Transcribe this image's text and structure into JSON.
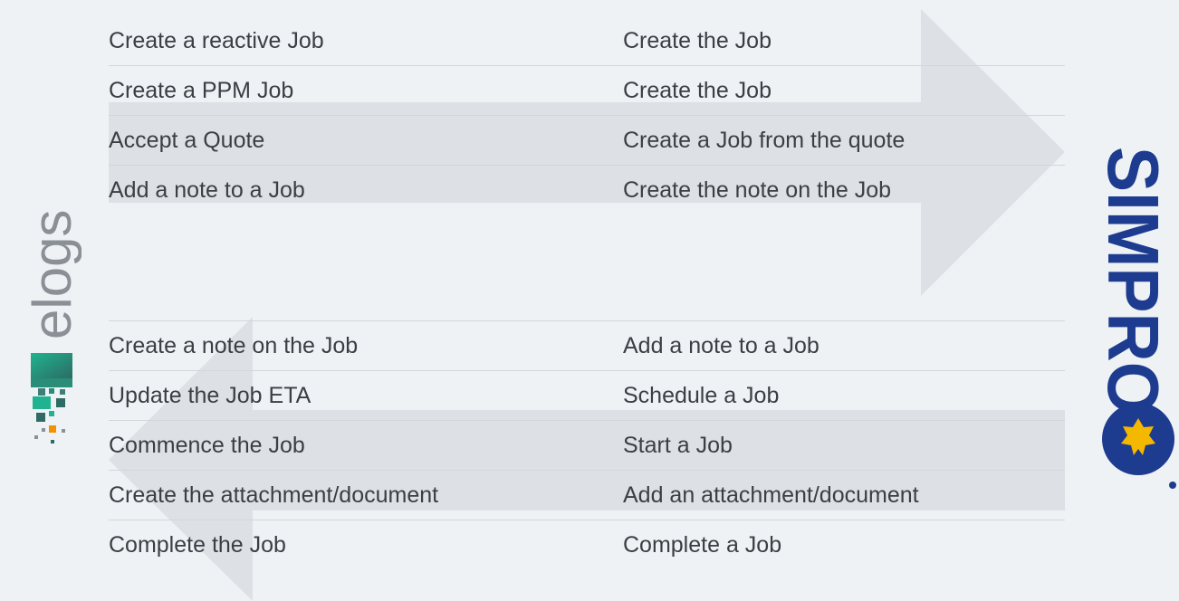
{
  "top_table": {
    "rows": [
      {
        "left": "Create a reactive Job",
        "right": "Create the Job"
      },
      {
        "left": "Create a PPM Job",
        "right": "Create the Job"
      },
      {
        "left": "Accept a Quote",
        "right": "Create a Job from the quote"
      },
      {
        "left": "Add a note to a Job",
        "right": "Create the note on the Job"
      }
    ]
  },
  "bottom_table": {
    "rows": [
      {
        "left": "Create a note on the Job",
        "right": "Add a note to a Job"
      },
      {
        "left": "Update the Job ETA",
        "right": "Schedule a Job"
      },
      {
        "left": "Commence the Job",
        "right": "Start a Job"
      },
      {
        "left": "Create the attachment/document",
        "right": "Add an attachment/document"
      },
      {
        "left": "Complete the Job",
        "right": "Complete a Job"
      }
    ]
  },
  "logos": {
    "left_word": "elogs",
    "right_word": "SIMPRO"
  },
  "colors": {
    "background": "#eef2f5",
    "arrow": "#dde1e5",
    "text": "#3a3f44",
    "simpro_blue": "#1d3b8f",
    "simpro_star": "#f5b800",
    "elogs_teal": "#1fb48f",
    "elogs_dark": "#2d6b64",
    "elogs_orange": "#f39200",
    "elogs_gray": "#8a9095"
  }
}
